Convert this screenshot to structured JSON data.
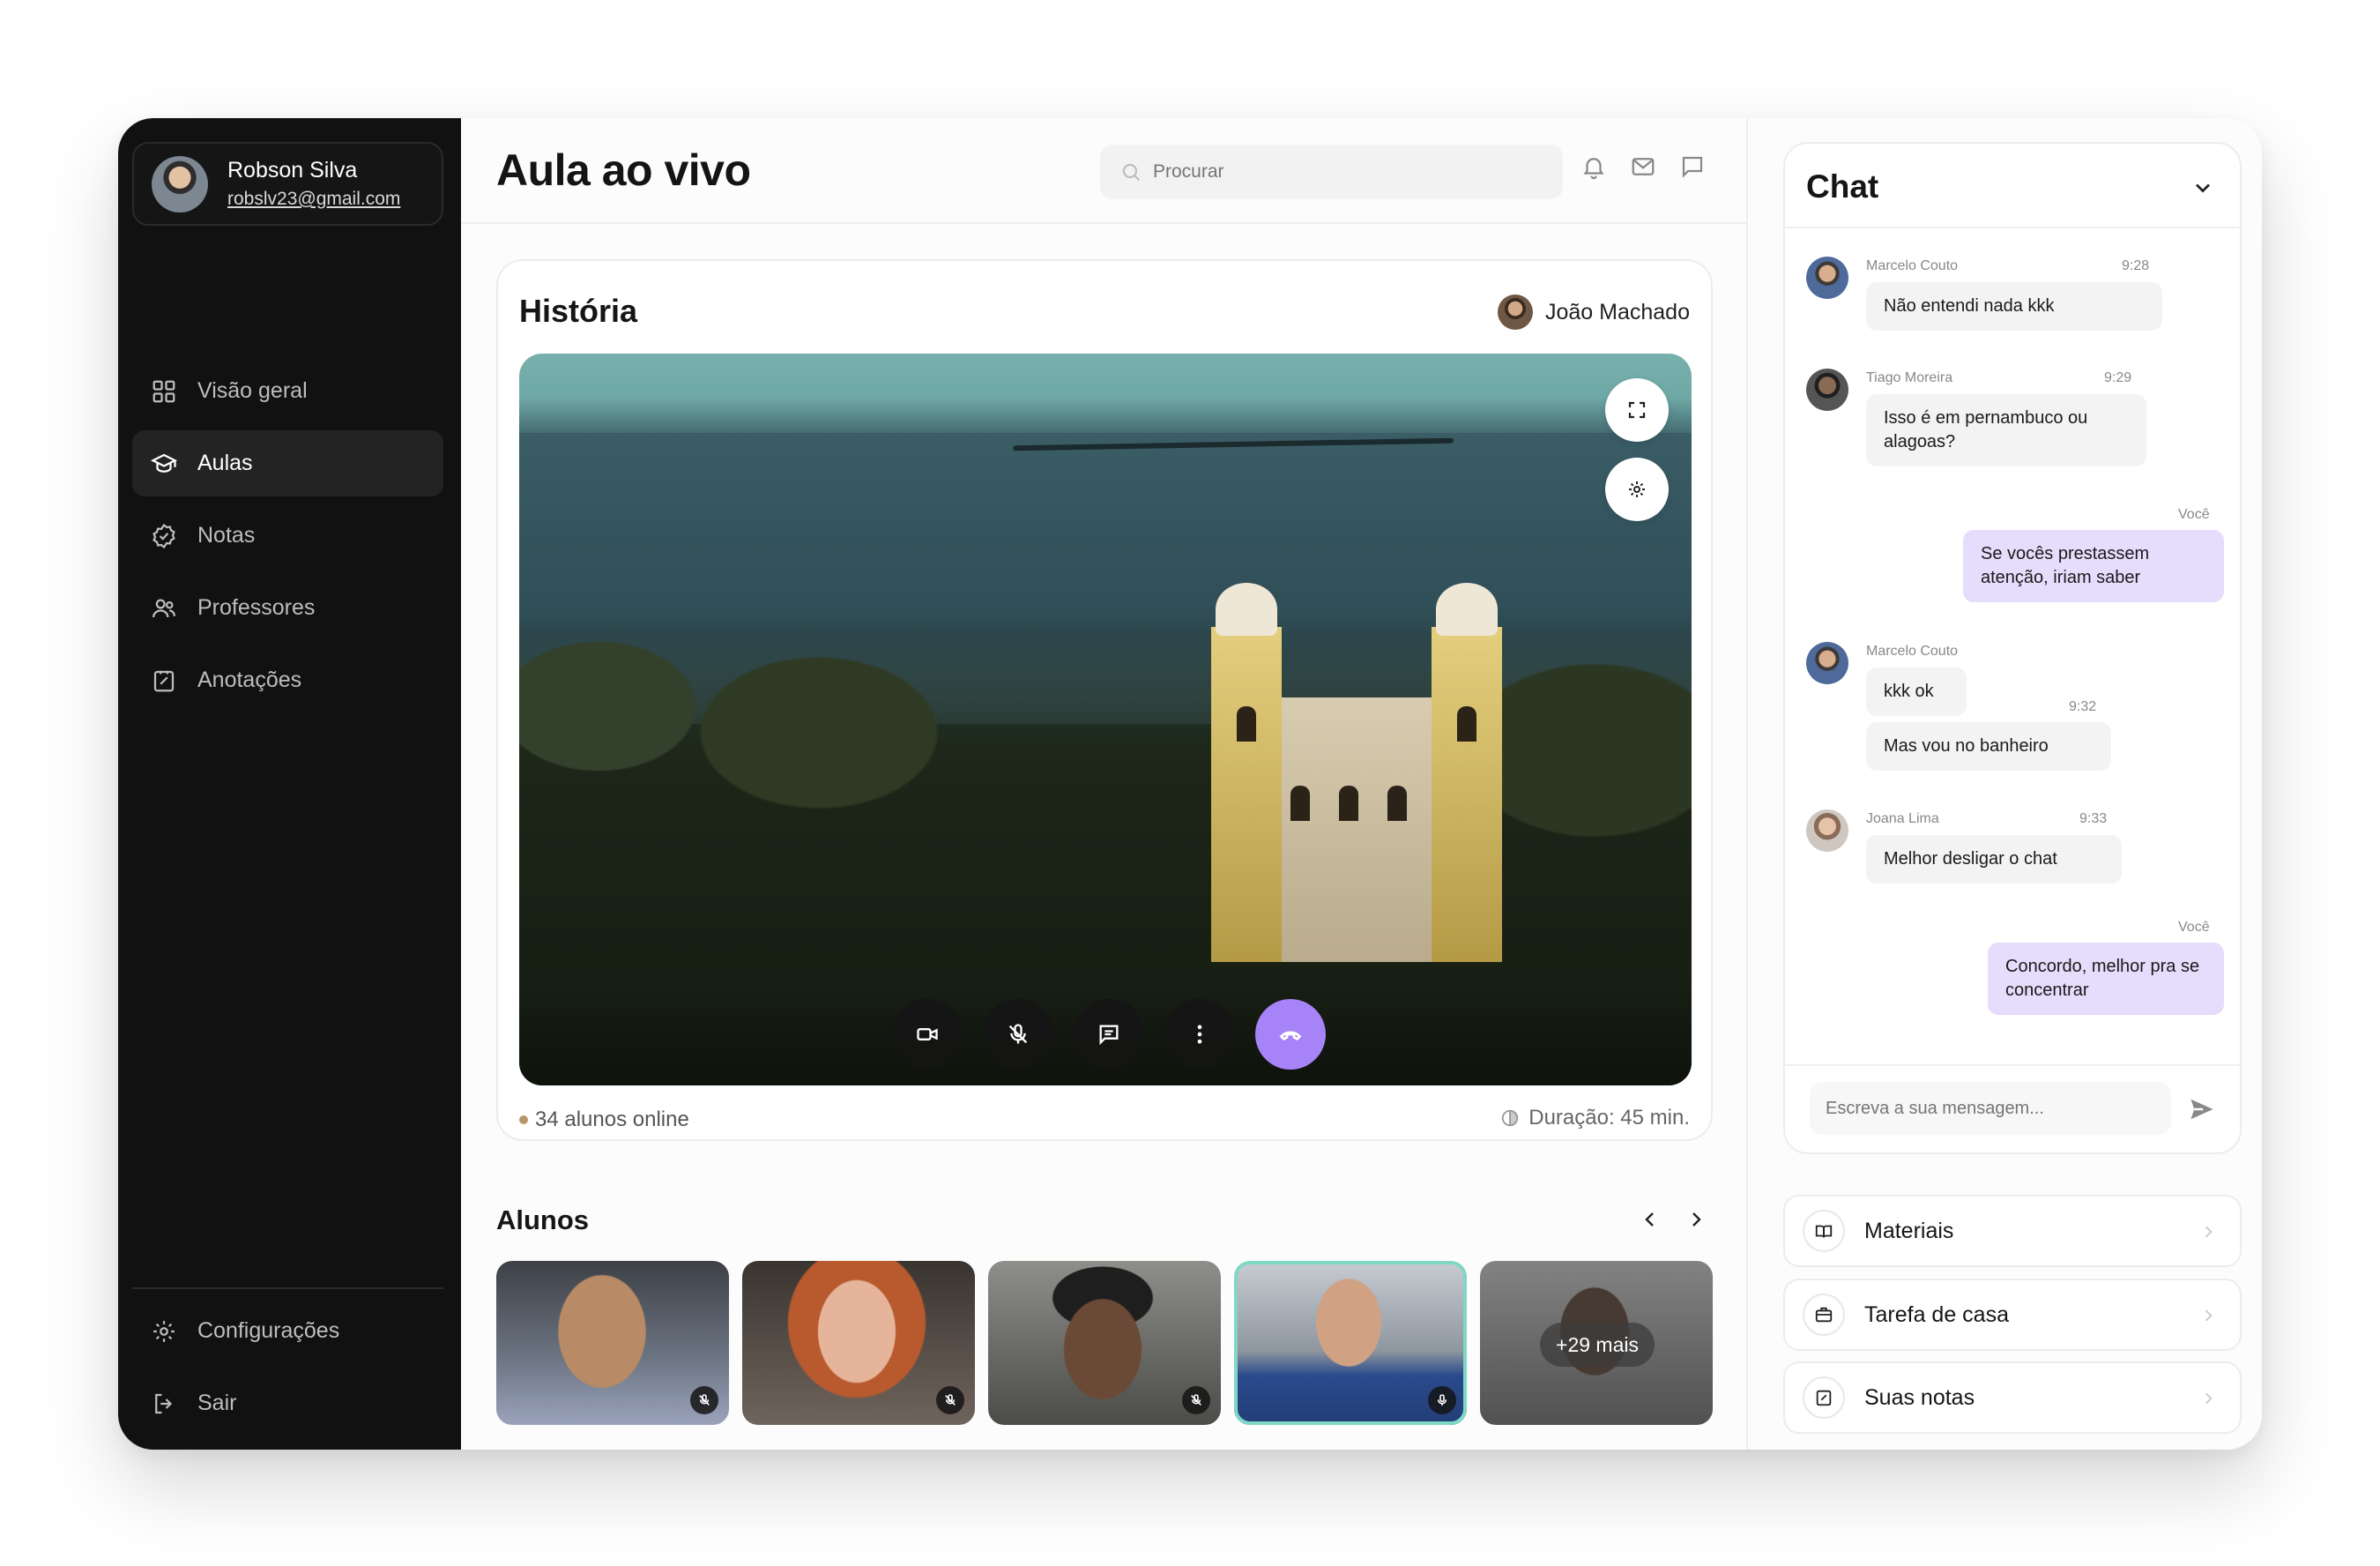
{
  "profile": {
    "name": "Robson Silva",
    "email": "robslv23@gmail.com"
  },
  "nav": {
    "items": [
      {
        "label": "Visão geral",
        "icon": "grid-icon",
        "active": false
      },
      {
        "label": "Aulas",
        "icon": "graduation-cap-icon",
        "active": true
      },
      {
        "label": "Notas",
        "icon": "badge-check-icon",
        "active": false
      },
      {
        "label": "Professores",
        "icon": "users-icon",
        "active": false
      },
      {
        "label": "Anotações",
        "icon": "note-edit-icon",
        "active": false
      }
    ],
    "bottom": [
      {
        "label": "Configurações",
        "icon": "gear-icon"
      },
      {
        "label": "Sair",
        "icon": "logout-icon"
      }
    ]
  },
  "header": {
    "title": "Aula ao vivo",
    "search_placeholder": "Procurar"
  },
  "class": {
    "subject": "História",
    "teacher": "João Machado",
    "online_count": "34 alunos online",
    "duration": "Duração: 45 min."
  },
  "students": {
    "title": "Alunos",
    "more_label": "+29 mais"
  },
  "chat": {
    "title": "Chat",
    "input_placeholder": "Escreva a sua mensagem...",
    "messages": [
      {
        "author": "Marcelo Couto",
        "time": "9:28",
        "text": "Não entendi nada kkk"
      },
      {
        "author": "Tiago Moreira",
        "time": "9:29",
        "text": "Isso é em pernambuco ou alagoas?"
      },
      {
        "author": "Você",
        "text": "Se vocês prestassem atenção, iriam saber"
      },
      {
        "author": "Marcelo Couto",
        "text": "kkk ok"
      },
      {
        "time": "9:32",
        "text": "Mas vou no banheiro"
      },
      {
        "author": "Joana Lima",
        "time": "9:33",
        "text": "Melhor desligar o chat"
      },
      {
        "author": "Você",
        "text": "Concordo, melhor pra se concentrar"
      }
    ]
  },
  "actions": [
    {
      "label": "Materiais",
      "icon": "book-icon"
    },
    {
      "label": "Tarefa de casa",
      "icon": "briefcase-icon"
    },
    {
      "label": "Suas notas",
      "icon": "note-edit-icon"
    }
  ],
  "colors": {
    "accent": "#a684f8",
    "sidebar": "#111111",
    "my_bubble": "#e6dcfb",
    "active_tile_border": "#7fd8c6"
  }
}
